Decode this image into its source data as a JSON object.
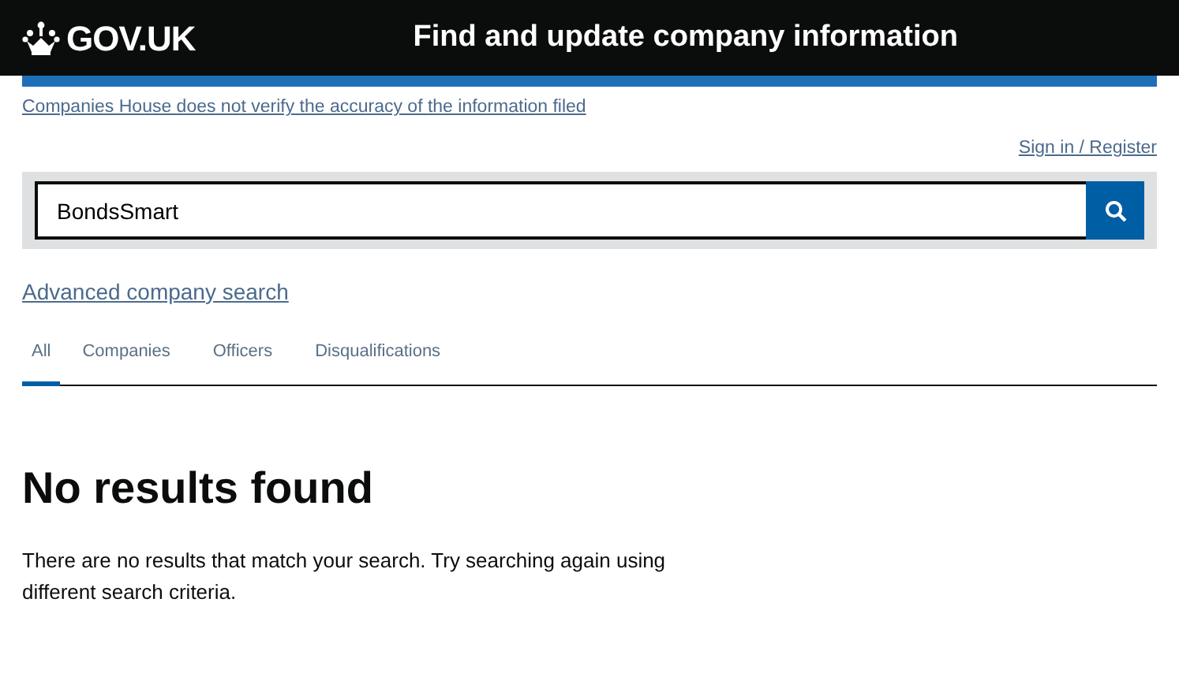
{
  "header": {
    "logo": "GOV.UK",
    "title": "Find and update company information"
  },
  "notice": "Companies House does not verify the accuracy of the information filed",
  "sign_in": "Sign in / Register",
  "search": {
    "value": "BondsSmart"
  },
  "advanced_link": "Advanced company search",
  "tabs": [
    {
      "label": "All",
      "selected": true
    },
    {
      "label": "Companies",
      "selected": false
    },
    {
      "label": "Officers",
      "selected": false
    },
    {
      "label": "Disqualifications",
      "selected": false
    }
  ],
  "heading": "No results found",
  "message": "There are no results that match your search. Try searching again using different search criteria."
}
